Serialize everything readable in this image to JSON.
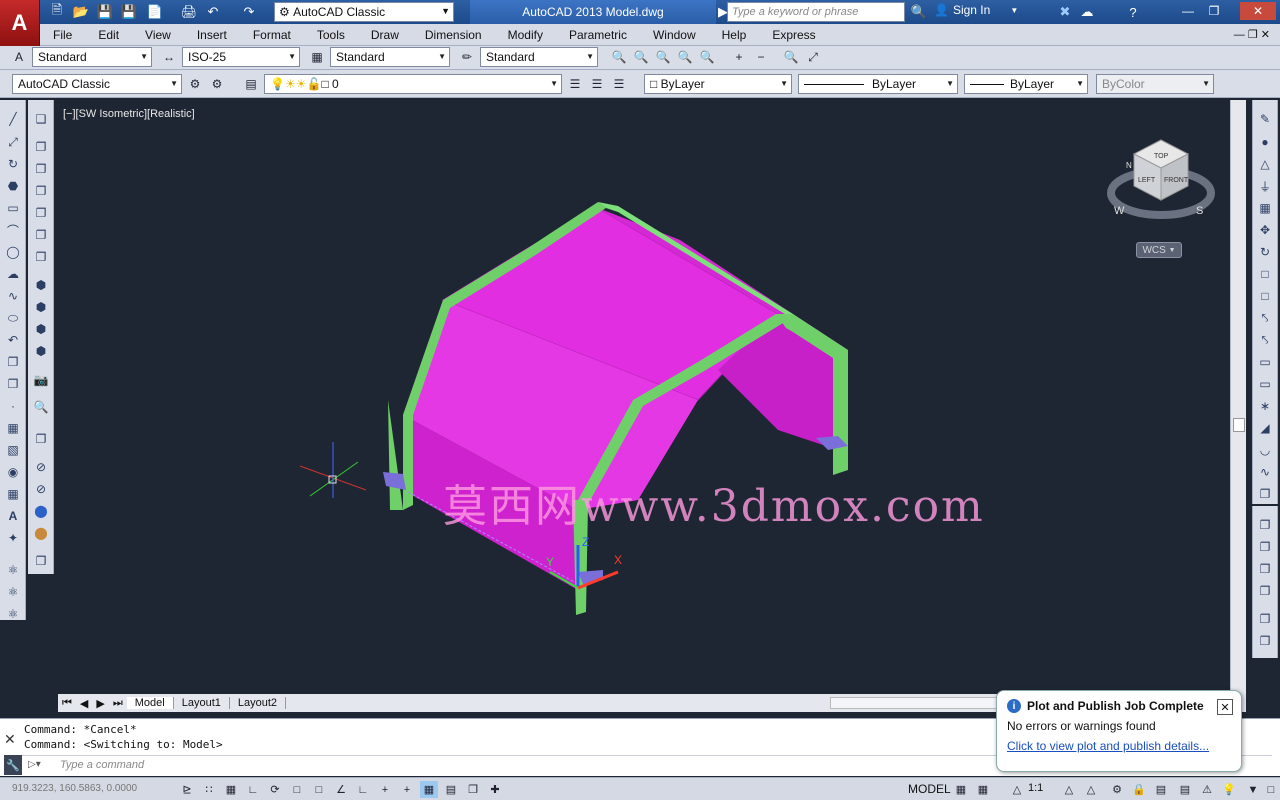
{
  "title": {
    "app_logo": "A",
    "window_title": "AutoCAD 2013    Model.dwg",
    "workspace": "AutoCAD Classic"
  },
  "search": {
    "placeholder": "Type a keyword or phrase"
  },
  "account": {
    "sign_in": "Sign In"
  },
  "menu": [
    "File",
    "Edit",
    "View",
    "Insert",
    "Format",
    "Tools",
    "Draw",
    "Dimension",
    "Modify",
    "Parametric",
    "Window",
    "Help",
    "Express"
  ],
  "styles": {
    "text_style": "Standard",
    "dim_style": "ISO-25",
    "table_style": "Standard",
    "mleader_style": "Standard"
  },
  "layers": {
    "workspace": "AutoCAD Classic",
    "current_layer": "0",
    "color": "ByLayer",
    "linetype": "ByLayer",
    "lineweight": "ByLayer",
    "plot_style": "ByColor"
  },
  "viewport": {
    "label": "[−][SW Isometric][Realistic]",
    "watermark": "莫西网www.3dmox.com"
  },
  "viewcube": {
    "top": "TOP",
    "left": "LEFT",
    "front": "FRONT",
    "w": "W",
    "s": "S",
    "n": "N",
    "wcs": "WCS"
  },
  "axes": {
    "x": "X",
    "y": "Y",
    "z": "Z"
  },
  "tabs": {
    "model": "Model",
    "layout1": "Layout1",
    "layout2": "Layout2"
  },
  "command": {
    "line1": "Command: *Cancel*",
    "line2": "Command:   <Switching to: Model>",
    "placeholder": "Type a command"
  },
  "status": {
    "coords": "919.3223, 160.5863, 0.0000",
    "model": "MODEL",
    "scale": "1:1"
  },
  "notification": {
    "title": "Plot and Publish Job Complete",
    "message": "No errors or warnings found",
    "link": "Click to view plot and publish details..."
  },
  "colors": {
    "title_bg": "#1d4a8a",
    "viewport_bg": "#1f2633",
    "roof": "#e02ee0",
    "frame": "#6fd06a"
  }
}
